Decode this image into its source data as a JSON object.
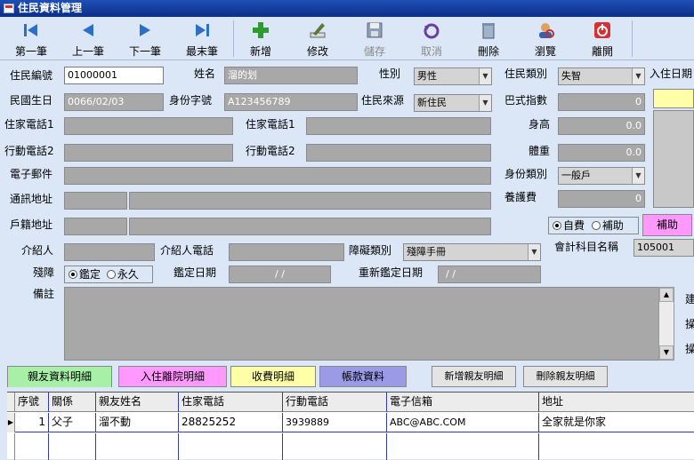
{
  "window": {
    "title": "住民資料管理"
  },
  "toolbar": {
    "first": "第一筆",
    "prev": "上一筆",
    "next": "下一筆",
    "last": "最末筆",
    "add": "新增",
    "edit": "修改",
    "save": "儲存",
    "cancel": "取消",
    "delete": "刪除",
    "browse": "瀏覽",
    "exit": "離開"
  },
  "form": {
    "resident_no_label": "住民編號",
    "resident_no": "01000001",
    "name_label": "姓名",
    "name": "溜的划",
    "gender_label": "性別",
    "gender": "男性",
    "resident_type_label": "住民類別",
    "resident_type": "失智",
    "admit_date_label": "入住日期",
    "birth_label": "民國生日",
    "birth": "0066/02/03",
    "id_label": "身份字號",
    "id": "A123456789",
    "source_label": "住民來源",
    "source": "新住民",
    "barthel_label": "巴式指數",
    "barthel": "0",
    "home_phone1_label": "住家電話1",
    "home_phone1_label2": "住家電話1",
    "mobile1_label": "行動電話2",
    "mobile2_label": "行動電話2",
    "height_label": "身高",
    "height": "0.0",
    "weight_label": "體重",
    "weight": "0.0",
    "email_label": "電子郵件",
    "identity_label": "身份類別",
    "identity": "一般戶",
    "mail_addr_label": "通訊地址",
    "care_fee_label": "養護費",
    "care_fee": "0",
    "reg_addr_label": "戶籍地址",
    "self_pay": "自費",
    "subsidy": "補助",
    "subsidy_button": "補助",
    "referrer_label": "介紹人",
    "referrer_phone_label": "介紹人電話",
    "disability_type_label": "障礙類別",
    "disability_type": "殘障手冊",
    "account_label": "會計科目名稱",
    "account": "105001",
    "disability_label": "殘障",
    "assessed": "鑑定",
    "permanent": "永久",
    "assess_date_label": "鑑定日期",
    "assess_date": "/   /",
    "reassess_date_label": "重新鑑定日期",
    "reassess_date": "/   /",
    "note_label": "備註",
    "right_cut1": "建",
    "right_cut2": "操",
    "right_cut3": "操"
  },
  "tabs": {
    "family": "親友資料明細",
    "admission": "入住離院明細",
    "fees": "收費明細",
    "accounts": "帳款資料",
    "add_family": "新增親友明細",
    "delete_family": "刪除親友明細"
  },
  "grid": {
    "headers": [
      "序號",
      "關係",
      "親友姓名",
      "住家電話",
      "行動電話",
      "電子信箱",
      "地址"
    ],
    "rows": [
      [
        "1",
        "父子",
        "溜不動",
        "28825252",
        "3939889",
        "ABC@ABC.COM",
        "全家就是你家"
      ]
    ]
  },
  "colors": {
    "titlebar": "#0a2f8a",
    "background": "#dbe6f7",
    "tab_green": "#a8f0a8",
    "tab_pink": "#ff99ff",
    "tab_yellow": "#ffffa8",
    "tab_purple": "#9a9ae6"
  }
}
